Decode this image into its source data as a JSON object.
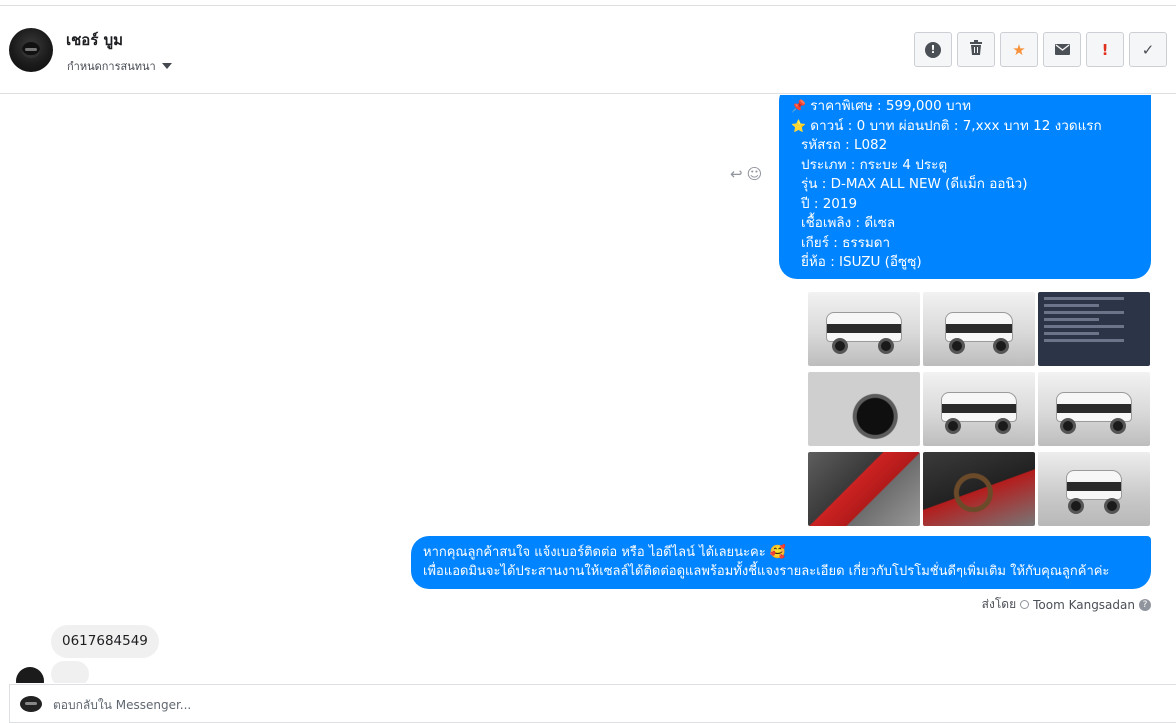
{
  "header": {
    "name": "เชอร์ บูม",
    "subtitle": "กำหนดการสนทนา",
    "actions": [
      {
        "icon": "alert-circle-icon",
        "label": "!"
      },
      {
        "icon": "trash-icon",
        "label": "🗑"
      },
      {
        "icon": "star-icon",
        "label": "★"
      },
      {
        "icon": "envelope-icon",
        "label": "✉"
      },
      {
        "icon": "exclamation-icon",
        "label": "!"
      },
      {
        "icon": "check-icon",
        "label": "✓"
      }
    ]
  },
  "car_message": {
    "lines": [
      {
        "emoji": "📌",
        "text": "ราคาพิเศษ : 599,000 บาท"
      },
      {
        "emoji": "⭐",
        "text": "ดาวน์ : 0 บาท ผ่อนปกติ : 7,xxx บาท 12 งวดแรก"
      },
      {
        "emoji": "",
        "text": "รหัสรถ : L082"
      },
      {
        "emoji": "",
        "text": "ประเภท : กระบะ 4 ประตู"
      },
      {
        "emoji": "",
        "text": "รุ่น : D-MAX ALL NEW (ดีแม็ก ออนิว)"
      },
      {
        "emoji": "",
        "text": "ปี : 2019"
      },
      {
        "emoji": "",
        "text": "เชื้อเพลิง : ดีเซล"
      },
      {
        "emoji": "",
        "text": "เกียร์ : ธรรมดา"
      },
      {
        "emoji": "",
        "text": "ยี่ห้อ : ISUZU (อีซูซุ)"
      }
    ]
  },
  "photos": [
    {
      "kind": "car-front-angle"
    },
    {
      "kind": "car-rear"
    },
    {
      "kind": "spec-screenshot"
    },
    {
      "kind": "fender-wheel"
    },
    {
      "kind": "car-rear-angle"
    },
    {
      "kind": "car-rear-side"
    },
    {
      "kind": "interior-seats"
    },
    {
      "kind": "steering-wheel"
    },
    {
      "kind": "car-front"
    }
  ],
  "followup_message": {
    "line1": "หากคุณลูกค้าสนใจ แจ้งเบอร์ติดต่อ หรือ ไอดีไลน์ ได้เลยนะคะ 🥰",
    "line2": "เพื่อแอดมินจะได้ประสานงานให้เซลล์ได้ติดต่อดูแลพร้อมทั้งชี้แจงรายละเอียด เกี่ยวกับโปรโมชั่นดีๆเพิ่มเติม ให้กับคุณลูกค้าค่ะ"
  },
  "sent_by": {
    "prefix": "ส่งโดย",
    "name": "Toom Kangsadan",
    "help": "?"
  },
  "incoming_message": {
    "text": "0617684549"
  },
  "composer": {
    "placeholder": "ตอบกลับใน Messenger..."
  },
  "colors": {
    "accent": "#0084ff",
    "incoming_bubble": "#f1f0f0",
    "star": "#f7923b"
  }
}
